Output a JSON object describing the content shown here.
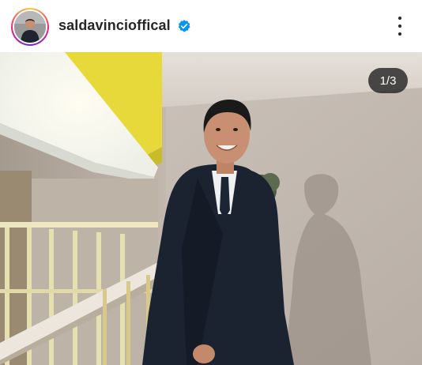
{
  "post": {
    "username": "saldavincioffical",
    "verified": true,
    "avatar_icon": "profile-photo",
    "more_icon": "more-vertical-icon",
    "media_counter": "1/3"
  }
}
